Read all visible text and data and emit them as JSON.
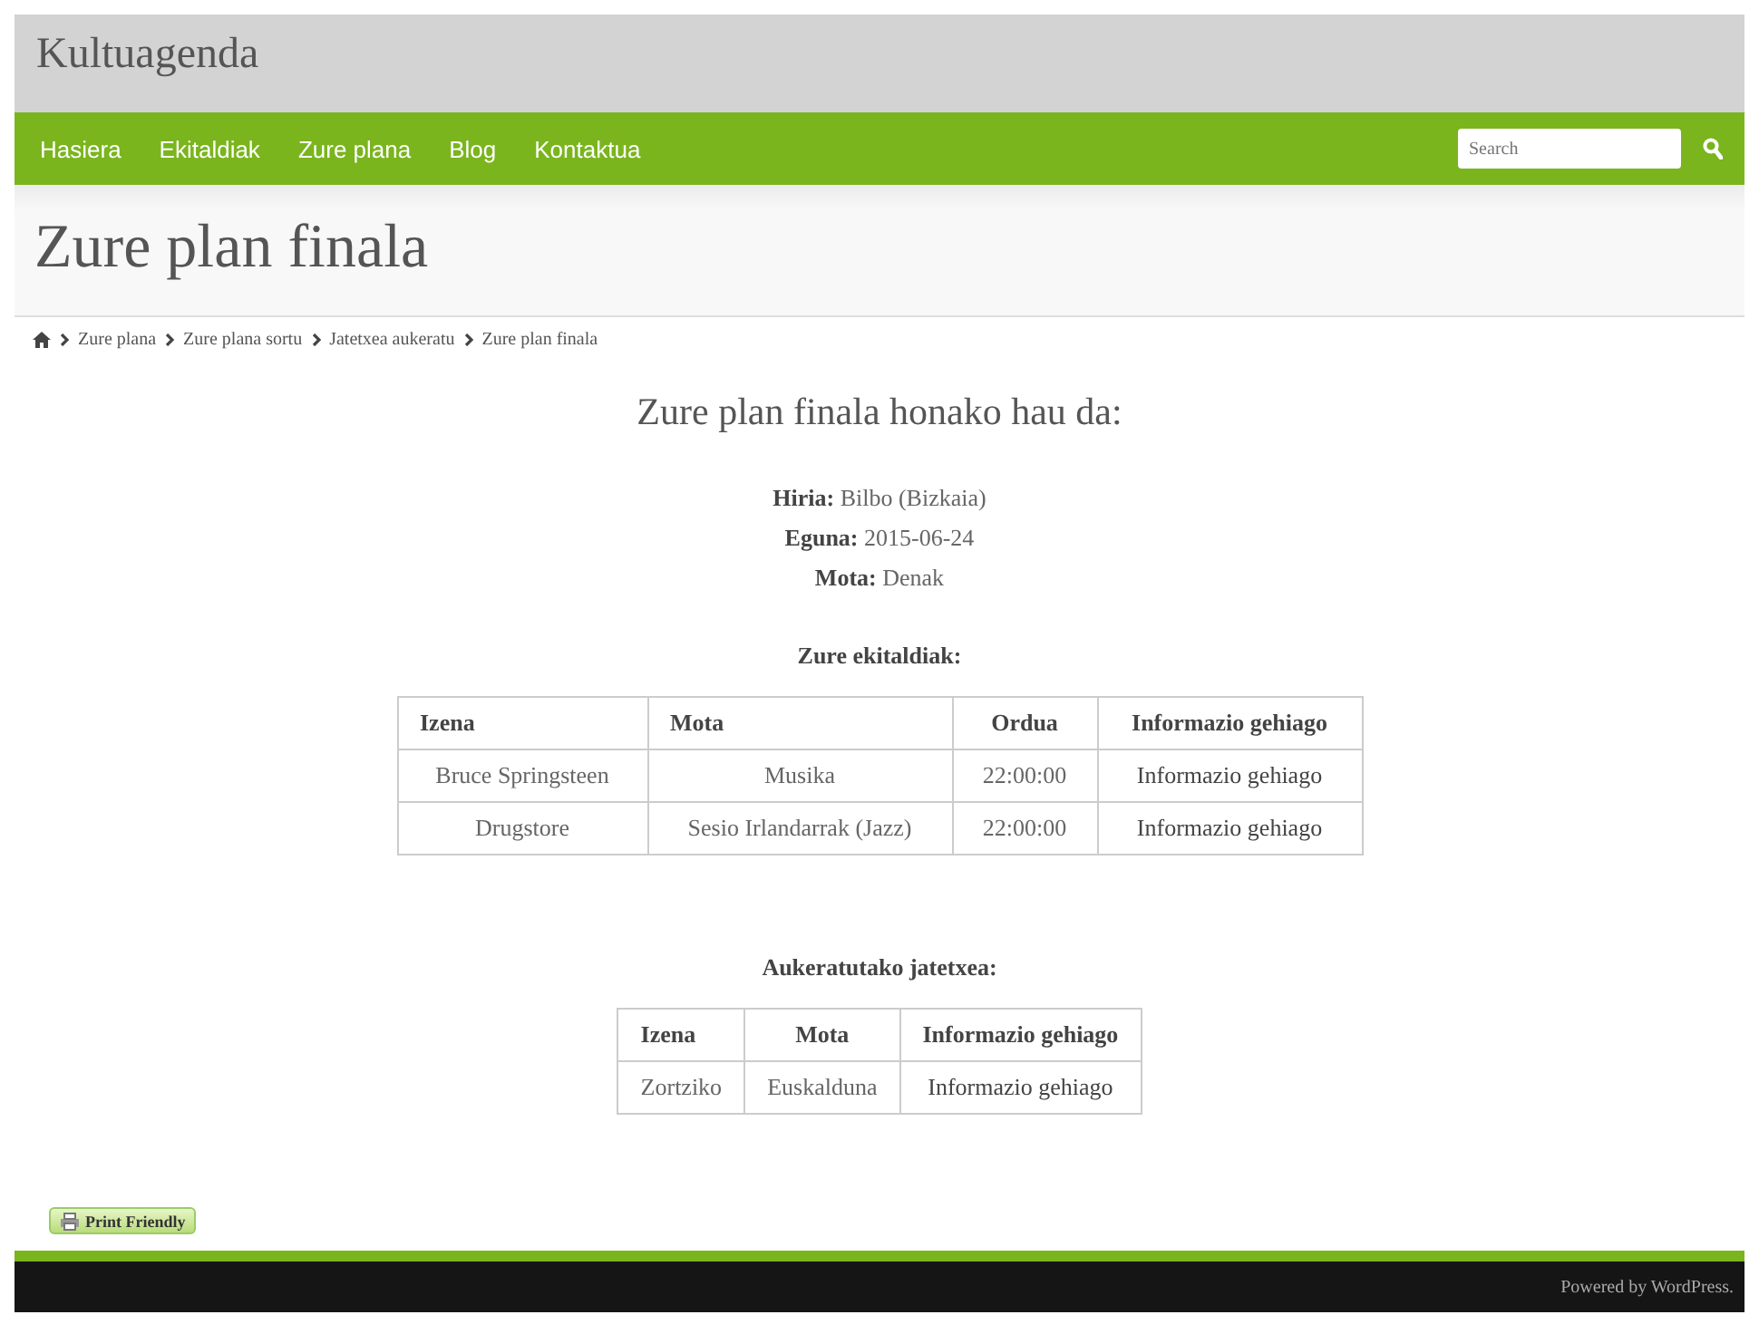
{
  "site": {
    "title": "Kultuagenda"
  },
  "nav": {
    "items": [
      {
        "label": "Hasiera"
      },
      {
        "label": "Ekitaldiak"
      },
      {
        "label": "Zure plana"
      },
      {
        "label": "Blog"
      },
      {
        "label": "Kontaktua"
      }
    ],
    "search": {
      "placeholder": "Search"
    }
  },
  "page_title": "Zure plan finala",
  "breadcrumb": [
    "Zure plana",
    "Zure plana sortu",
    "Jatetxea aukeratu",
    "Zure plan finala"
  ],
  "heading": "Zure plan finala honako hau da:",
  "summary": [
    "**Hiria:** Bilbo (Bizkaia)",
    "**Eguna:** 2015-06-24",
    "**Mota:** Denak"
  ],
  "events": {
    "title": "Zure ekitaldiak:",
    "columns": [
      "Izena",
      "Mota",
      "Ordua",
      "Informazio gehiago"
    ],
    "rows": [
      [
        "Bruce Springsteen",
        "Musika",
        "22:00:00",
        "Informazio gehiago"
      ],
      [
        "Drugstore",
        "Sesio Irlandarrak (Jazz)",
        "22:00:00",
        "Informazio gehiago"
      ]
    ]
  },
  "restaurant": {
    "title": "Aukeratutako jatetxea:",
    "columns": [
      "Izena",
      "Mota",
      "Informazio gehiago"
    ],
    "rows": [
      [
        "Zortziko",
        "Euskalduna",
        "Informazio gehiago"
      ]
    ]
  },
  "print_button": "Print Friendly",
  "footer": "Powered by WordPress."
}
